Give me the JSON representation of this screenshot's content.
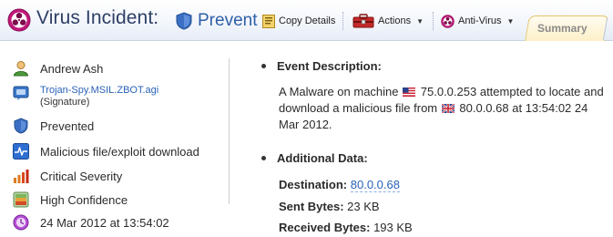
{
  "header": {
    "title": "Virus Incident:",
    "status_label": "Prevent",
    "copy_details_label": "Copy Details",
    "actions_label": "Actions",
    "antivirus_label": "Anti-Virus",
    "tab_summary_label": "Summary"
  },
  "details": {
    "user": "Andrew Ash",
    "signature_name": "Trojan-Spy.MSIL.ZBOT.agi",
    "signature_sub": "(Signature)",
    "action": "Prevented",
    "type": "Malicious file/exploit download",
    "severity": "Critical Severity",
    "confidence": "High Confidence",
    "timestamp": "24 Mar 2012 at 13:54:02"
  },
  "event": {
    "heading": "Event Description:",
    "text_part1": "A Malware on machine",
    "source_ip": "75.0.0.253",
    "text_part2": "attempted to locate and download a malicious file from",
    "dest_ip": "80.0.0.68",
    "text_part3": "at 13:54:02 24 Mar 2012."
  },
  "additional": {
    "heading": "Additional Data:",
    "destination_label": "Destination:",
    "destination_value": "80.0.0.68",
    "sent_label": "Sent Bytes:",
    "sent_value": "23 KB",
    "received_label": "Received Bytes:",
    "received_value": "193 KB"
  },
  "colors": {
    "title": "#2e3f66",
    "accent_blue": "#2e5fa8",
    "link": "#2a62b8",
    "tab_fill": "#fdf0c9",
    "tab_border": "#e4c56a"
  },
  "icons": {
    "header": "biohazard-icon",
    "status": "shield-icon",
    "copy": "copy-details-icon",
    "actions": "toolbox-icon",
    "antivirus": "biohazard-icon",
    "user": "user-icon",
    "signature": "signature-icon",
    "prevented": "shield-icon",
    "type": "pulse-icon",
    "severity": "signal-bars-icon",
    "confidence": "confidence-icon",
    "time": "clock-icon",
    "source_flag": "us-flag-icon",
    "dest_flag": "uk-flag-icon"
  }
}
